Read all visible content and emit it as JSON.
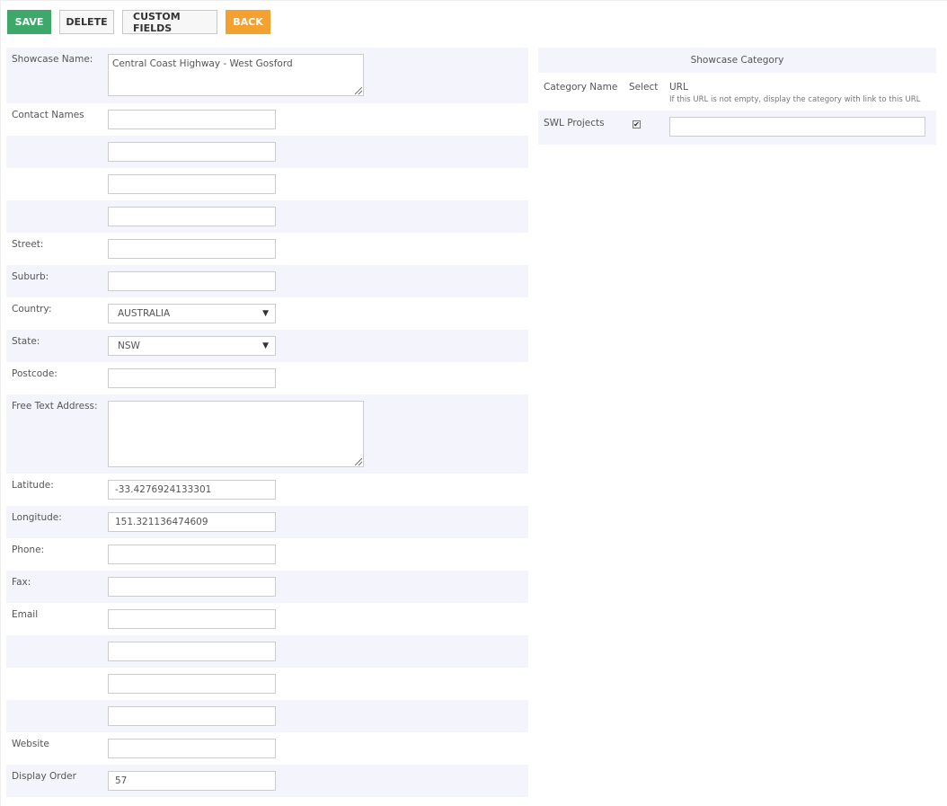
{
  "toolbar": {
    "save": "SAVE",
    "delete": "DELETE",
    "custom_fields": "CUSTOM FIELDS",
    "back": "BACK",
    "colors": {
      "save": "#3ea86a",
      "back": "#f5a130"
    }
  },
  "form": {
    "showcase_name": {
      "label": "Showcase Name:",
      "value": "Central Coast Highway - West Gosford"
    },
    "contact_names": {
      "label": "Contact Names",
      "values": [
        "",
        "",
        "",
        ""
      ]
    },
    "street": {
      "label": "Street:",
      "value": ""
    },
    "suburb": {
      "label": "Suburb:",
      "value": ""
    },
    "country": {
      "label": "Country:",
      "value": "AUSTRALIA"
    },
    "state": {
      "label": "State:",
      "value": "NSW"
    },
    "postcode": {
      "label": "Postcode:",
      "value": ""
    },
    "free_text_address": {
      "label": "Free Text Address:",
      "value": ""
    },
    "latitude": {
      "label": "Latitude:",
      "value": "-33.4276924133301"
    },
    "longitude": {
      "label": "Longitude:",
      "value": "151.321136474609"
    },
    "phone": {
      "label": "Phone:",
      "value": ""
    },
    "fax": {
      "label": "Fax:",
      "value": ""
    },
    "email": {
      "label": "Email",
      "values": [
        "",
        "",
        "",
        ""
      ]
    },
    "website": {
      "label": "Website",
      "value": ""
    },
    "display_order": {
      "label": "Display Order",
      "value": "57"
    }
  },
  "category": {
    "title": "Showcase Category",
    "col_name": "Category Name",
    "col_select": "Select",
    "col_url": "URL",
    "url_hint": "If this URL is not empty, display the category with link to this URL",
    "rows": [
      {
        "name": "SWL Projects",
        "checked": true,
        "url": ""
      }
    ]
  }
}
